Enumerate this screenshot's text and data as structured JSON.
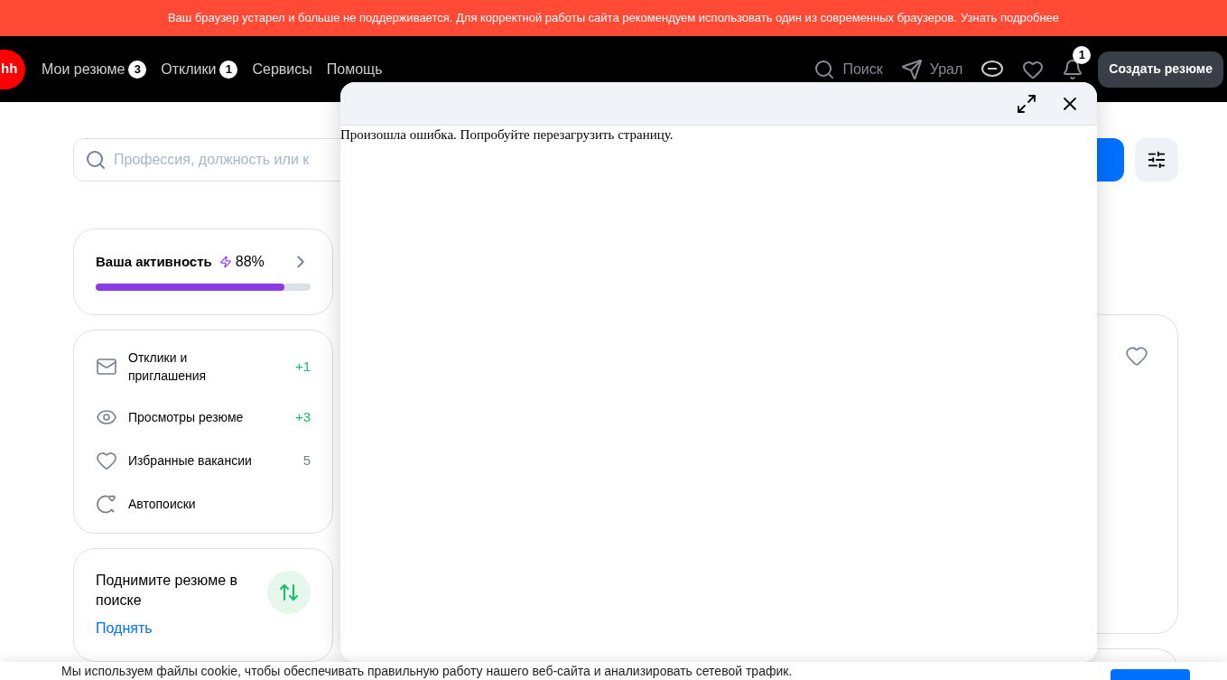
{
  "browser_notice": {
    "text": "Ваш браузер устарел и больше не поддерживается. Для корректной работы сайта рекомендуем использовать один из современных браузеров.",
    "link": "Узнать подробнее"
  },
  "header": {
    "logo": "hh",
    "nav": [
      {
        "label": "Мои резюме",
        "badge": "3"
      },
      {
        "label": "Отклики",
        "badge": "1"
      },
      {
        "label": "Сервисы"
      },
      {
        "label": "Помощь"
      }
    ],
    "actions": [
      {
        "kind": "search",
        "label": "Поиск"
      },
      {
        "kind": "location",
        "label": "Урал"
      },
      {
        "kind": "chat"
      },
      {
        "kind": "favorites"
      },
      {
        "kind": "notifications",
        "badge": "1"
      }
    ],
    "create_button": "Создать резюме"
  },
  "search": {
    "placeholder": "Профессия, должность или к"
  },
  "activity": {
    "title": "Ваша активность",
    "value": "88%",
    "level": 0.88
  },
  "stats": [
    {
      "kind": "mail",
      "label": "Отклики и приглашения",
      "count": "+1",
      "highlight": true
    },
    {
      "kind": "eye",
      "label": "Просмотры резюме",
      "count": "+3",
      "highlight": true
    },
    {
      "kind": "heart",
      "label": "Избранные вакансии",
      "count": "5",
      "highlight": false
    },
    {
      "kind": "autosearch",
      "label": "Автопоиски"
    }
  ],
  "promo": {
    "title": "Поднимите резюме в поиске",
    "link": "Поднять"
  },
  "modal": {
    "message": "Произошла ошибка. Попробуйте перезагрузить страницу."
  },
  "cookie": {
    "text": "Мы используем файлы cookie, чтобы обеспечивать правильную работу нашего веб-сайта и анализировать сетевой трафик."
  }
}
